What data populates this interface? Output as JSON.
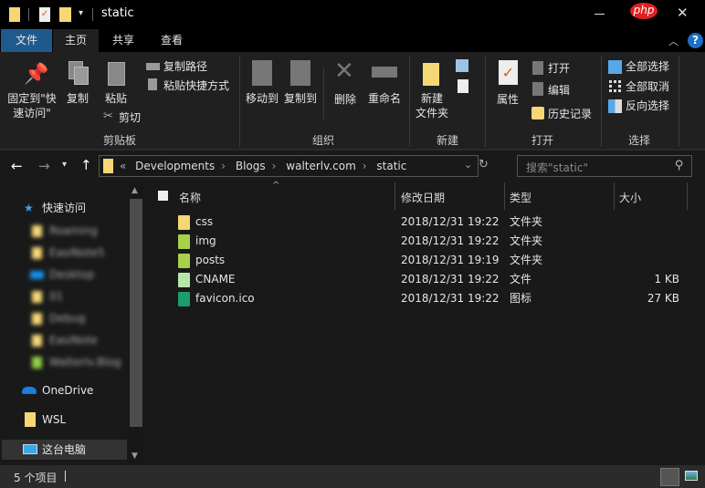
{
  "window": {
    "title": "static",
    "php_badge": "php"
  },
  "tabs": [
    {
      "label": "文件"
    },
    {
      "label": "主页"
    },
    {
      "label": "共享"
    },
    {
      "label": "查看"
    }
  ],
  "ribbon": {
    "clipboard": {
      "label": "剪贴板",
      "pin": "固定到\"快速访问\"",
      "pin_l1": "固定到\"快",
      "pin_l2": "速访问\"",
      "copy": "复制",
      "paste": "粘贴",
      "copy_path": "复制路径",
      "paste_shortcut": "粘贴快捷方式",
      "cut": "剪切"
    },
    "organize": {
      "label": "组织",
      "move_to": "移动到",
      "copy_to": "复制到",
      "delete": "删除",
      "rename": "重命名"
    },
    "new": {
      "label": "新建",
      "new_folder_l1": "新建",
      "new_folder_l2": "文件夹"
    },
    "open": {
      "label": "打开",
      "properties": "属性",
      "open": "打开",
      "edit": "编辑",
      "history": "历史记录"
    },
    "select": {
      "label": "选择",
      "select_all": "全部选择",
      "select_none": "全部取消",
      "invert": "反向选择"
    }
  },
  "address": {
    "overflow": "«",
    "crumbs": [
      "Developments",
      "Blogs",
      "walterlv.com",
      "static"
    ],
    "search_placeholder": "搜索\"static\""
  },
  "sidebar": {
    "quick_access": "快速访问",
    "pinned": [
      "Roaming",
      "EasiNote5",
      "Desktop",
      "01",
      "Debug",
      "EasiNote",
      "Walterlv.Blog"
    ],
    "onedrive": "OneDrive",
    "wsl": "WSL",
    "this_pc": "这台电脑"
  },
  "columns": {
    "name": "名称",
    "date": "修改日期",
    "type": "类型",
    "size": "大小"
  },
  "files": [
    {
      "name": "css",
      "date": "2018/12/31 19:22",
      "type": "文件夹",
      "size": "",
      "icon": "folder",
      "color": "#f6d775"
    },
    {
      "name": "img",
      "date": "2018/12/31 19:22",
      "type": "文件夹",
      "size": "",
      "icon": "folder",
      "color": "#a6d24a"
    },
    {
      "name": "posts",
      "date": "2018/12/31 19:19",
      "type": "文件夹",
      "size": "",
      "icon": "folder",
      "color": "#a6d24a"
    },
    {
      "name": "CNAME",
      "date": "2018/12/31 19:22",
      "type": "文件",
      "size": "1 KB",
      "icon": "file",
      "color": "#b5e8a8"
    },
    {
      "name": "favicon.ico",
      "date": "2018/12/31 19:22",
      "type": "图标",
      "size": "27 KB",
      "icon": "icon-file",
      "color": "#1e9c6e"
    }
  ],
  "status": {
    "count": "5 个项目"
  }
}
